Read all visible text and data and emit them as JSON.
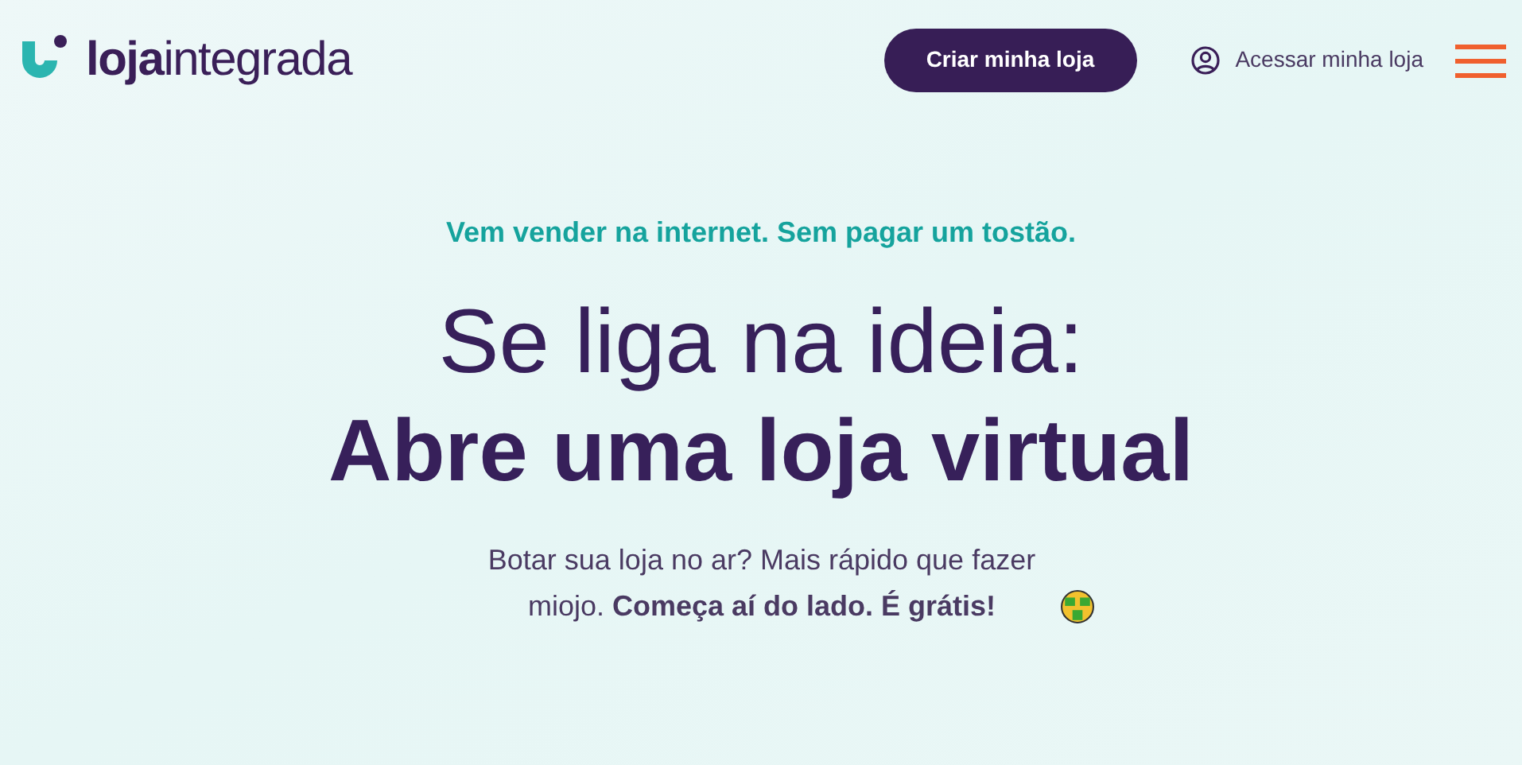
{
  "header": {
    "logo": "**loja**integrada",
    "cta_button": "Criar minha loja",
    "login_link": "Acessar minha loja"
  },
  "hero": {
    "tagline": "Vem vender na internet. Sem pagar um tostão.",
    "headline": [
      "Se liga na ideia:",
      "Abre uma loja virtual"
    ],
    "description": "Botar sua loja no ar? Mais rápido que fazer miojo. **Começa aí do lado. É grátis!**"
  }
}
